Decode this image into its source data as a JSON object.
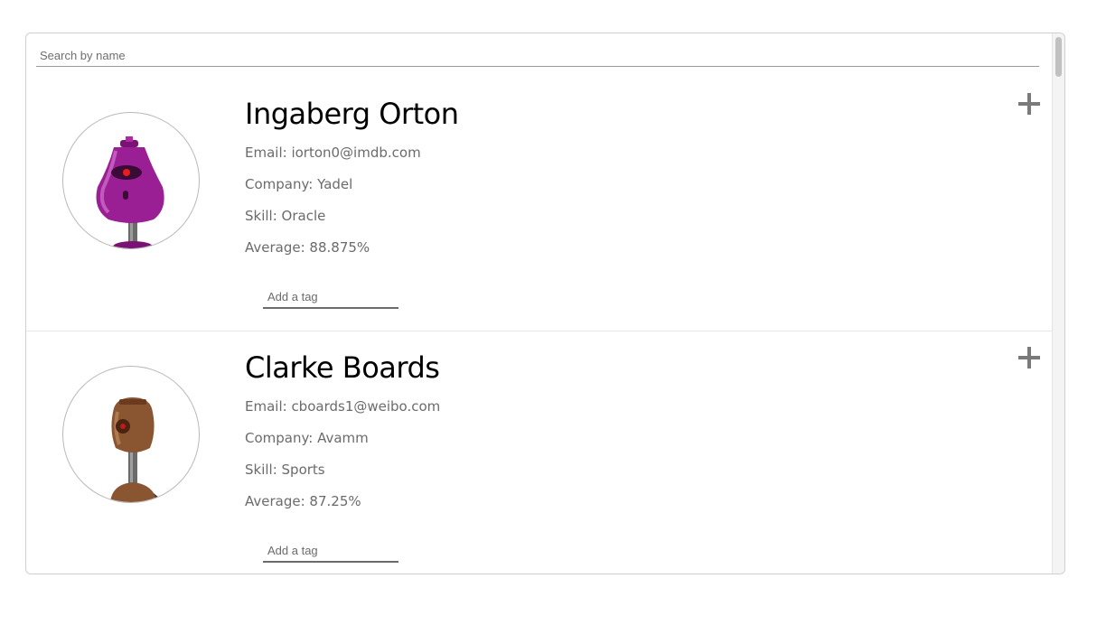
{
  "search": {
    "placeholder": "Search by name"
  },
  "students": [
    {
      "name": "Ingaberg Orton",
      "email": "Email: iorton0@imdb.com",
      "company": "Company: Yadel",
      "skill": "Skill: Oracle",
      "average": "Average: 88.875%",
      "tag_placeholder": "Add a tag",
      "avatar_color": "#9a1f94",
      "avatar_icon": "robot-avatar-icon"
    },
    {
      "name": "Clarke Boards",
      "email": "Email: cboards1@weibo.com",
      "company": "Company: Avamm",
      "skill": "Skill: Sports",
      "average": "Average: 87.25%",
      "tag_placeholder": "Add a tag",
      "avatar_color": "#8a5531",
      "avatar_icon": "robot-avatar-icon"
    }
  ],
  "expand_icon": "plus-icon"
}
